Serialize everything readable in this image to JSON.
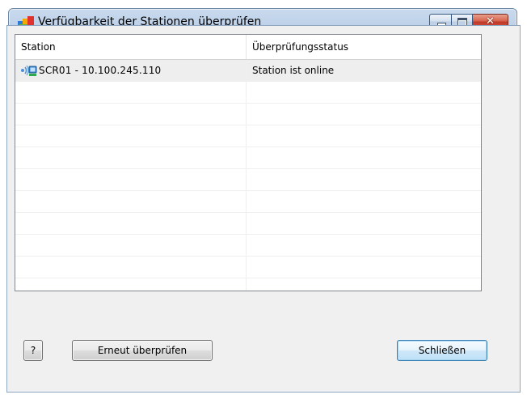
{
  "window": {
    "title": "Verfügbarkeit der Stationen überprüfen",
    "controls": {
      "minimize_icon": "minimize-icon",
      "maximize_icon": "maximize-icon",
      "close_glyph": "✕"
    }
  },
  "list": {
    "columns": [
      "Station",
      "Überprüfungsstatus"
    ],
    "rows": [
      {
        "station": "SCR01 - 10.100.245.110",
        "status": "Station ist online",
        "icon": "network-station-icon"
      },
      {
        "station": "",
        "status": ""
      },
      {
        "station": "",
        "status": ""
      },
      {
        "station": "",
        "status": ""
      },
      {
        "station": "",
        "status": ""
      },
      {
        "station": "",
        "status": ""
      },
      {
        "station": "",
        "status": ""
      },
      {
        "station": "",
        "status": ""
      },
      {
        "station": "",
        "status": ""
      },
      {
        "station": "",
        "status": ""
      },
      {
        "station": "",
        "status": ""
      }
    ]
  },
  "buttons": {
    "help": "?",
    "recheck": "Erneut überprüfen",
    "close": "Schließen"
  },
  "colors": {
    "title_gradient_top": "#c9daee",
    "dialog_bg": "#f0f0f0",
    "close_button_red": "#c0392b",
    "default_button_border": "#3c7fb1"
  }
}
